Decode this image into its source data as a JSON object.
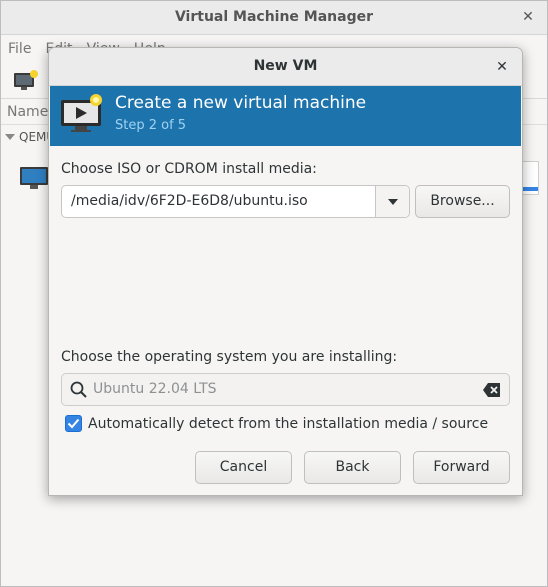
{
  "main_window": {
    "title": "Virtual Machine Manager",
    "menu": [
      "File",
      "Edit",
      "View",
      "Help"
    ],
    "column_header": "Name",
    "connection": "QEMU"
  },
  "dialog": {
    "title": "New VM",
    "banner": {
      "title": "Create a new virtual machine",
      "subtitle": "Step 2 of 5"
    },
    "iso_label": "Choose ISO or CDROM install media:",
    "iso_value": "/media/idv/6F2D-E6D8/ubuntu.iso",
    "browse_label": "Browse...",
    "os_label": "Choose the operating system you are installing:",
    "os_value": "Ubuntu 22.04 LTS",
    "auto_detect_label": "Automatically detect from the installation media / source",
    "auto_detect_checked": true,
    "buttons": {
      "cancel": "Cancel",
      "back": "Back",
      "forward": "Forward"
    }
  },
  "colors": {
    "banner_bg": "#1d73ac",
    "banner_subtitle": "#9fd2f2",
    "accent": "#3584e4"
  },
  "icons": {
    "close": "close-icon",
    "monitor": "monitor-icon",
    "search": "search-icon",
    "clear": "clear-icon",
    "dropdown": "chevron-down-icon",
    "check": "checkmark-icon"
  }
}
